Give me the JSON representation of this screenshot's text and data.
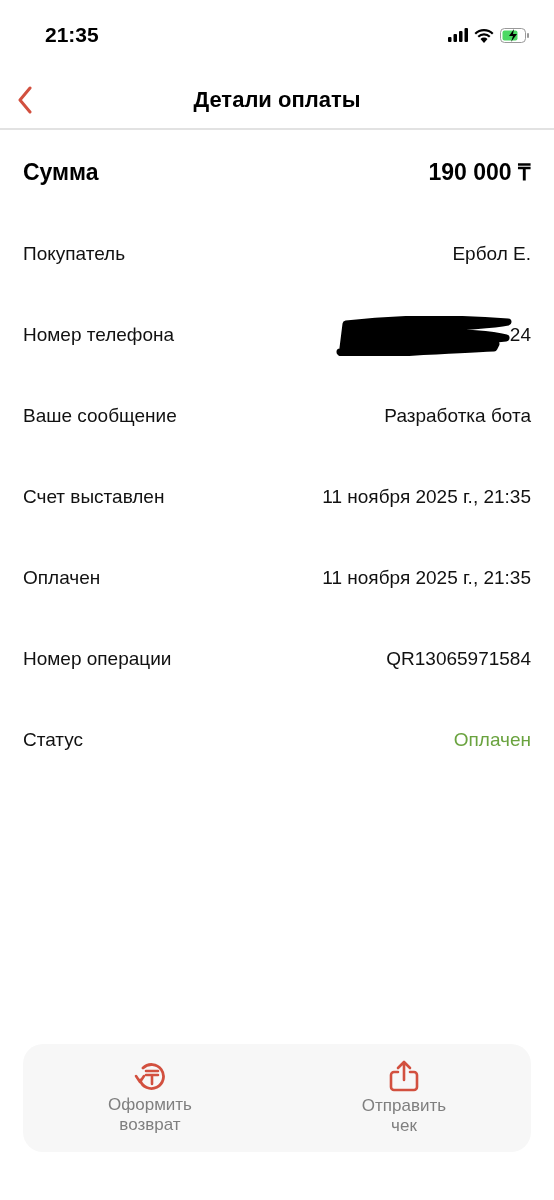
{
  "status_bar": {
    "time": "21:35"
  },
  "header": {
    "title": "Детали оплаты"
  },
  "total": {
    "label": "Сумма",
    "value": "190 000 ₸"
  },
  "rows": [
    {
      "kind": "plain",
      "label": "Покупатель",
      "value": "Ербол Е."
    },
    {
      "kind": "redacted",
      "label": "Номер телефона",
      "value": "24"
    },
    {
      "kind": "plain",
      "label": "Ваше сообщение",
      "value": "Разработка бота"
    },
    {
      "kind": "plain",
      "label": "Счет выставлен",
      "value": "11 ноября 2025 г., 21:35"
    },
    {
      "kind": "plain",
      "label": "Оплачен",
      "value": "11 ноября 2025 г., 21:35"
    },
    {
      "kind": "plain",
      "label": "Номер операции",
      "value": "QR13065971584"
    },
    {
      "kind": "status",
      "label": "Статус",
      "value": "Оплачен"
    }
  ],
  "actions": [
    {
      "kind": "refund",
      "label": "Оформить\nвозврат"
    },
    {
      "kind": "share",
      "label": "Отправить\nчек"
    }
  ]
}
